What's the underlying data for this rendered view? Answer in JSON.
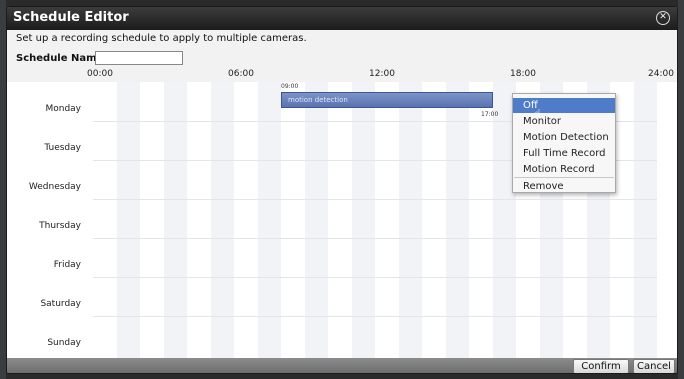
{
  "dialog": {
    "title": "Schedule Editor",
    "subtitle": "Set up a recording schedule to apply to multiple cameras.",
    "name_label": "Schedule Name:",
    "name_value": ""
  },
  "hours": [
    "00:00",
    "06:00",
    "12:00",
    "18:00",
    "24:00"
  ],
  "days": [
    "Monday",
    "Tuesday",
    "Wednesday",
    "Thursday",
    "Friday",
    "Saturday",
    "Sunday"
  ],
  "event": {
    "label": "motion detection",
    "start": "09:00",
    "end": "17:00"
  },
  "context_menu": {
    "items": [
      "Off",
      "Monitor",
      "Motion Detection",
      "Full Time Record",
      "Motion Record"
    ],
    "remove": "Remove",
    "selected": "Off"
  },
  "footer": {
    "confirm": "Confirm",
    "cancel": "Cancel"
  },
  "colors": {
    "titlebar": "#1c1c1c",
    "event_bar": "#5a73b0",
    "menu_selected": "#4f7cc9"
  }
}
